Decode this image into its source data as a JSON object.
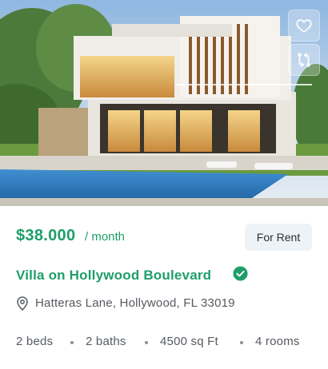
{
  "listing": {
    "price": "$38.000",
    "period": "/ month",
    "status_badge": "For Rent",
    "title": "Villa on Hollywood Boulevard",
    "address": "Hatteras Lane, Hollywood, FL 33019",
    "features": [
      "2 beds",
      "2 baths",
      "4500 sq Ft",
      "4 rooms"
    ]
  },
  "actions": {
    "favorite_icon": "heart-icon",
    "compare_icon": "compare-arrows-icon"
  },
  "colors": {
    "accent": "#1e9e6a",
    "badge_bg": "#eef3f8",
    "muted_text": "#555a60"
  }
}
